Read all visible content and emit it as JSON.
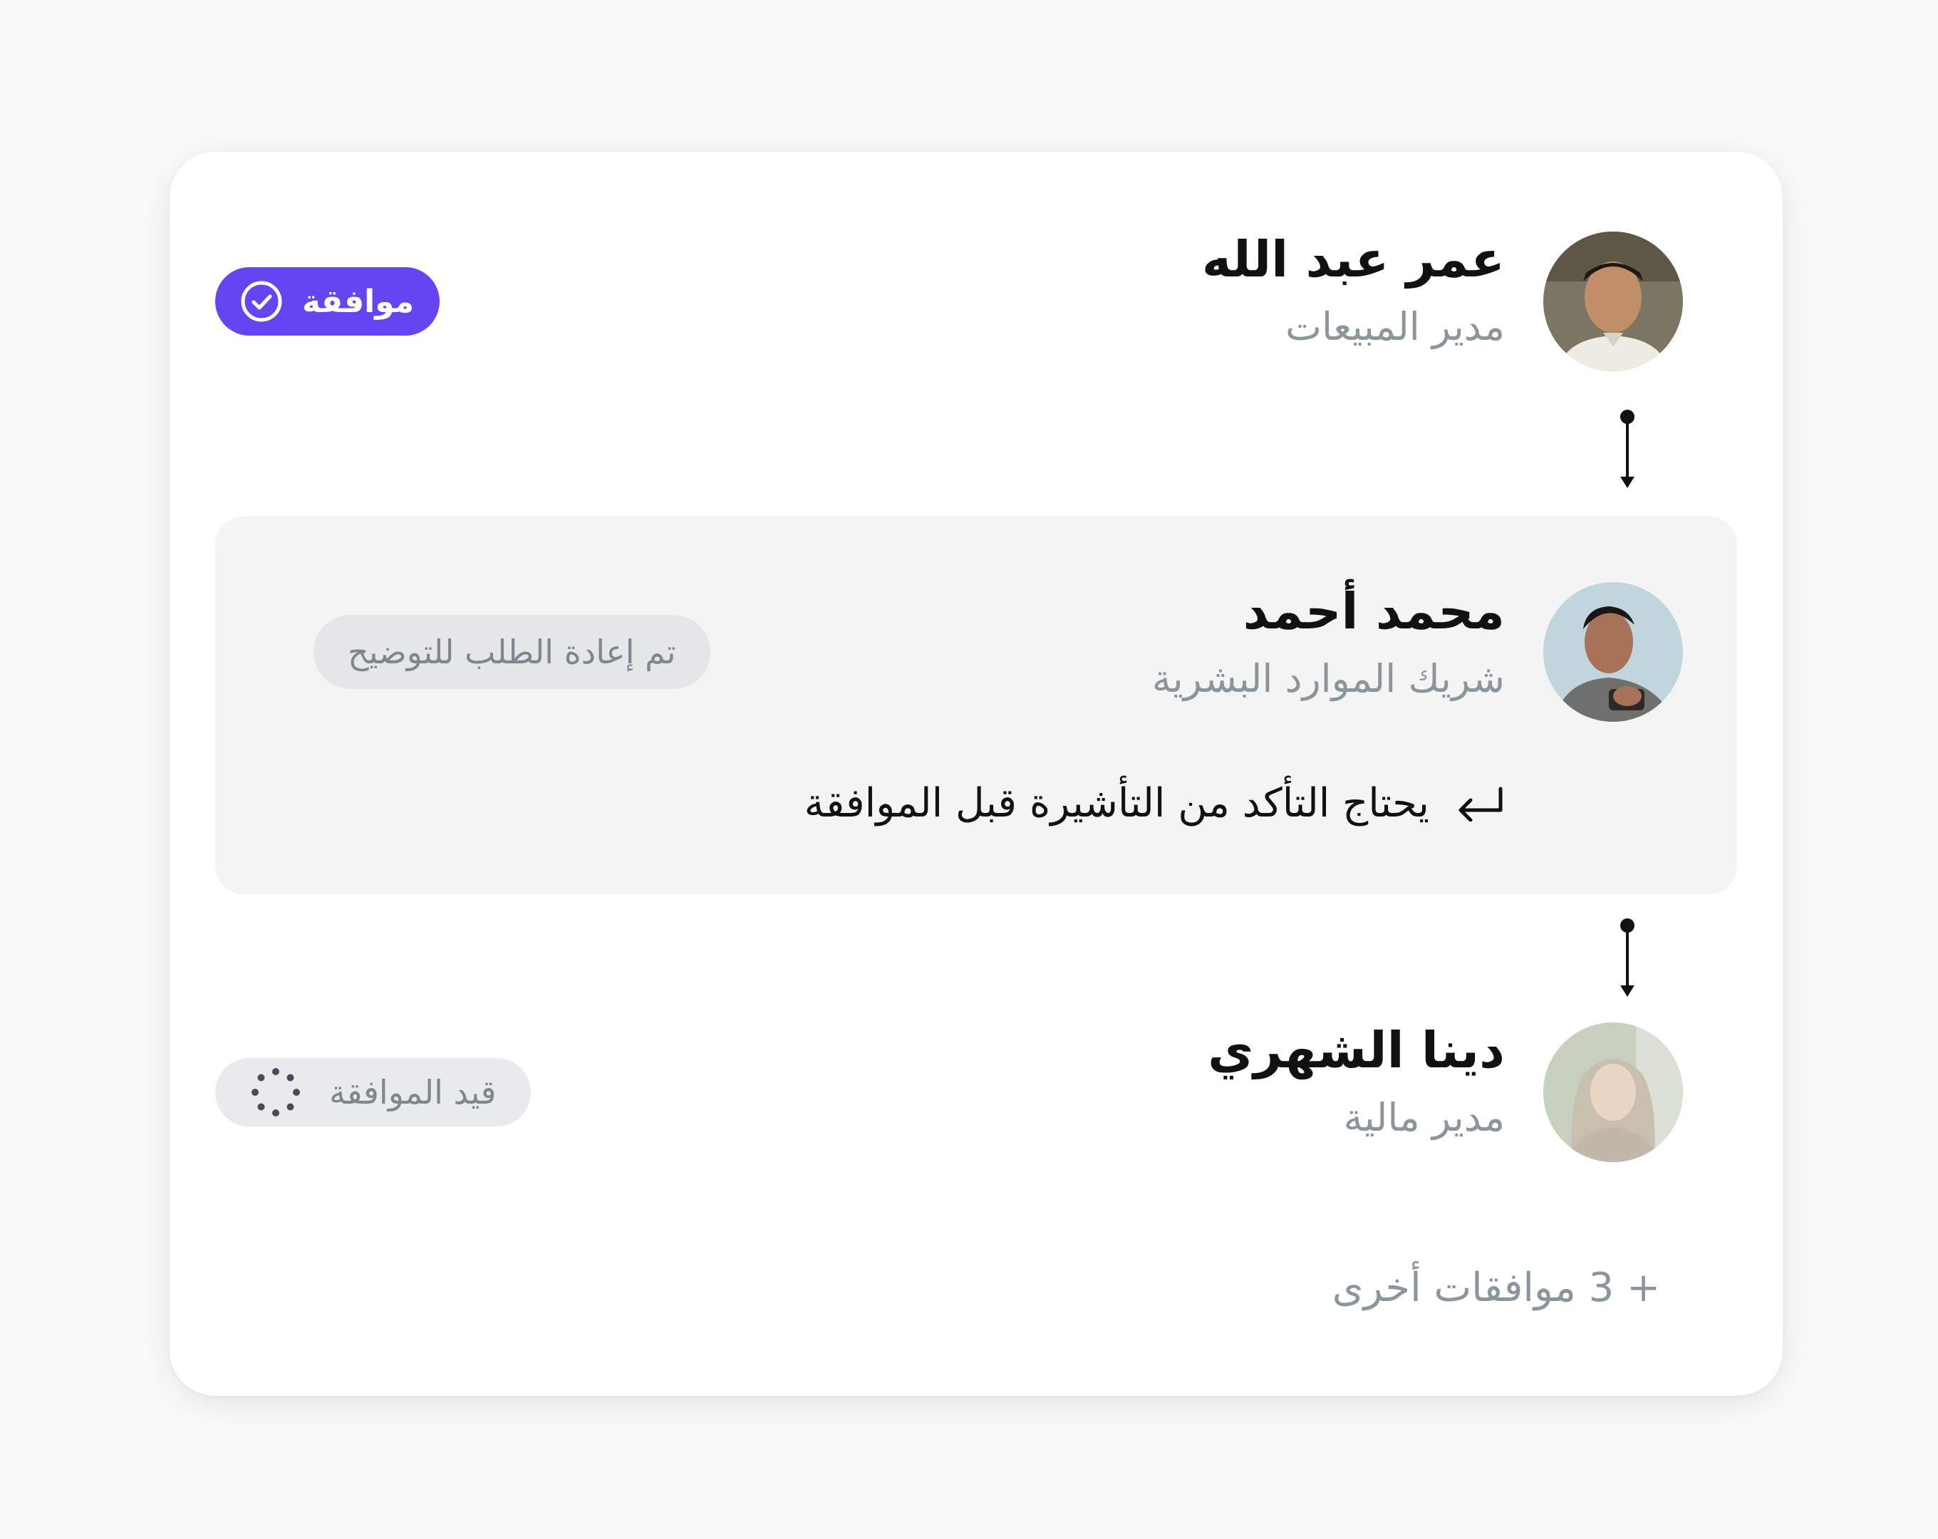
{
  "approval_chain": {
    "steps": [
      {
        "name": "عمر عبد الله",
        "role": "مدير المبيعات",
        "status_label": "موافقة",
        "status_icon": "check-circle-icon",
        "status_color": "#6544f1"
      },
      {
        "name": "محمد أحمد",
        "role": "شريك الموارد البشرية",
        "status_label": "تم إعادة الطلب للتوضيح",
        "note": "يحتاج التأكد من التأشيرة قبل الموافقة",
        "note_icon": "return-arrow-icon"
      },
      {
        "name": "دينا الشهري",
        "role": "مدير مالية",
        "status_label": "قيد الموافقة",
        "status_icon": "loading-spinner-icon"
      }
    ],
    "more_approvals": "+ 3 موافقات أخرى"
  }
}
